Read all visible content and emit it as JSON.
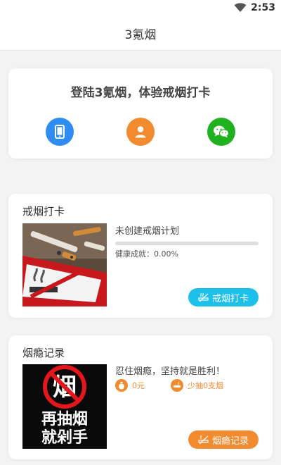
{
  "status_bar": {
    "time": "2:53",
    "wifi_icon": "wifi-icon"
  },
  "app_bar": {
    "title": "3氪烟"
  },
  "login": {
    "title": "登陆3氪烟，体验戒烟打卡",
    "buttons": [
      {
        "icon": "phone-icon",
        "color": "#2f8cf0"
      },
      {
        "icon": "user-icon",
        "color": "#f28a2e"
      },
      {
        "icon": "wechat-icon",
        "color": "#1fb11e"
      }
    ]
  },
  "quit_checkin": {
    "title": "戒烟打卡",
    "image": "no-smoking-photo",
    "status": "未创建戒烟计划",
    "progress": 0,
    "health_label": "健康成就：",
    "health_value": "0.00%",
    "button_label": "戒烟打卡",
    "button_color": "#1cc0ea"
  },
  "addiction_log": {
    "title": "烟瘾记录",
    "image_text_top": "烟",
    "image_line1": "再抽烟",
    "image_line2": "就剁手",
    "motto": "忍住烟瘾，坚持就是胜利！",
    "money_value": "0元",
    "cig_value": "少抽0支烟",
    "button_label": "烟瘾记录",
    "button_color": "#f28a2e"
  }
}
